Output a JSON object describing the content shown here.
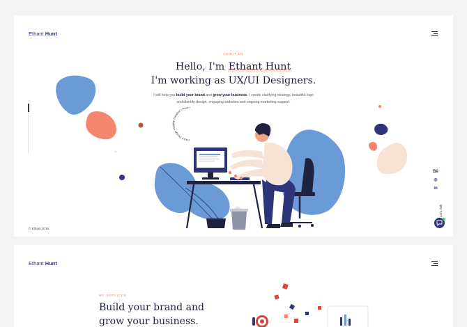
{
  "hero": {
    "logo": {
      "first": "Ethant",
      "last": "Hunt"
    },
    "eyebrow": "ABOUT ME",
    "headline_line1_prefix": "Hello, I'm ",
    "headline_line1_name": "Ethant Hunt",
    "headline_line2": "I'm working as UX/UI Designers.",
    "intro": {
      "p1": "I will help you ",
      "b1": "build your brand",
      "p2": " and ",
      "b2": "grow your business",
      "p3": ". I create clarifying strategy, beautiful logo",
      "line2": "and identity design, engaging websites and ongoing marketing support."
    },
    "circle_text": "UX/UI Design • Digital Creative • Print •",
    "copyright": "© Ethant 2019.",
    "socials": [
      "Bē",
      "◎",
      "in"
    ],
    "talk_label": "Let's Talk"
  },
  "services": {
    "logo": {
      "first": "Ethant",
      "last": "Hunt"
    },
    "eyebrow": "MY SERVICES",
    "title_line1": "Build your brand and",
    "title_line2": "grow your business."
  },
  "colors": {
    "navy": "#2d3477",
    "blue": "#6b9bd6",
    "coral": "#f3866c",
    "peach": "#f6e3d6",
    "dark": "#1f2340"
  },
  "icons": [
    "menu-icon",
    "behance-icon",
    "dribbble-icon",
    "linkedin-icon",
    "chat-icon"
  ]
}
